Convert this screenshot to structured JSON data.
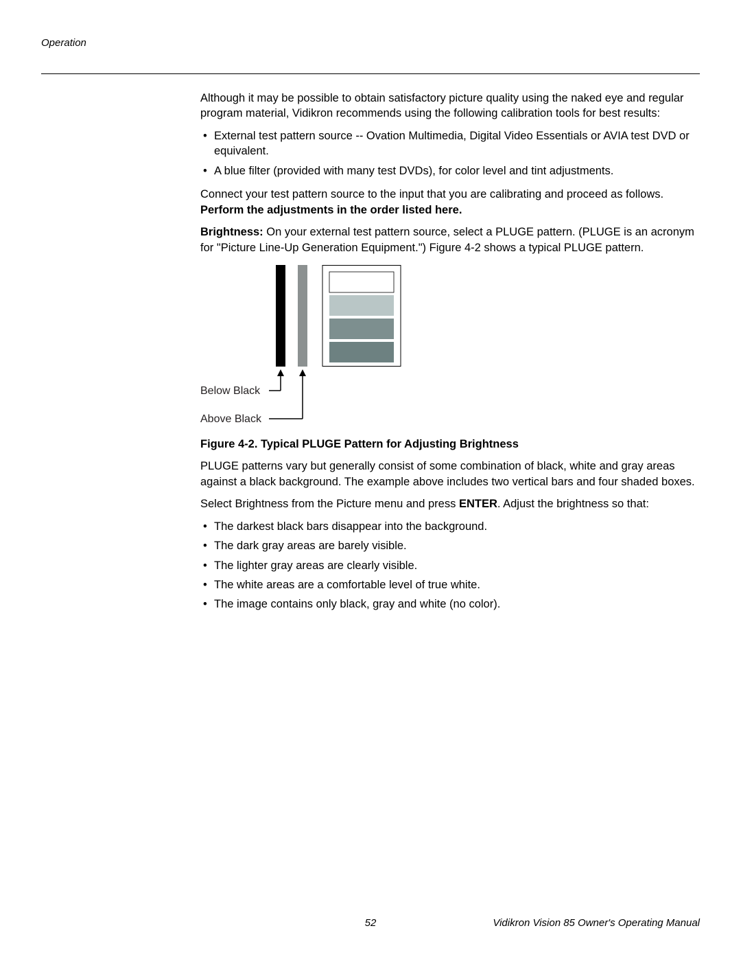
{
  "header": {
    "section": "Operation"
  },
  "body": {
    "p1": "Although it may be possible to obtain satisfactory picture quality using the naked eye and regular program material, Vidikron recommends using the following calibration tools for best results:",
    "list1": [
      "External test pattern source -- Ovation Multimedia, Digital Video Essentials or AVIA test DVD or equivalent.",
      "A blue filter (provided with many test DVDs), for color level and tint adjustments."
    ],
    "p2a": "Connect your test pattern source to the input that you are calibrating and proceed as follows. ",
    "p2b": "Perform the adjustments in the order listed here.",
    "p3label": "Brightness: ",
    "p3": "On your external test pattern source, select a PLUGE pattern. (PLUGE is an acronym for \"Picture Line-Up Generation Equipment.\") Figure 4-2 shows a typical PLUGE pattern.",
    "fig": {
      "below": "Below Black",
      "above": "Above Black",
      "caption": "Figure 4-2. Typical PLUGE Pattern for Adjusting Brightness"
    },
    "p4": "PLUGE patterns vary but generally consist of some combination of black, white and gray areas against a black background. The example above includes two vertical bars and four shaded boxes.",
    "p5a": "Select Brightness from the Picture menu and press ",
    "p5enter": "ENTER",
    "p5b": ". Adjust the brightness so that:",
    "list2": [
      "The darkest black bars disappear into the background.",
      "The dark gray areas are barely visible.",
      "The lighter gray areas are clearly visible.",
      "The white areas are a comfortable level of true white.",
      "The image contains only black, gray and white (no color)."
    ]
  },
  "footer": {
    "page": "52",
    "title": "Vidikron Vision 85 Owner's Operating Manual"
  }
}
